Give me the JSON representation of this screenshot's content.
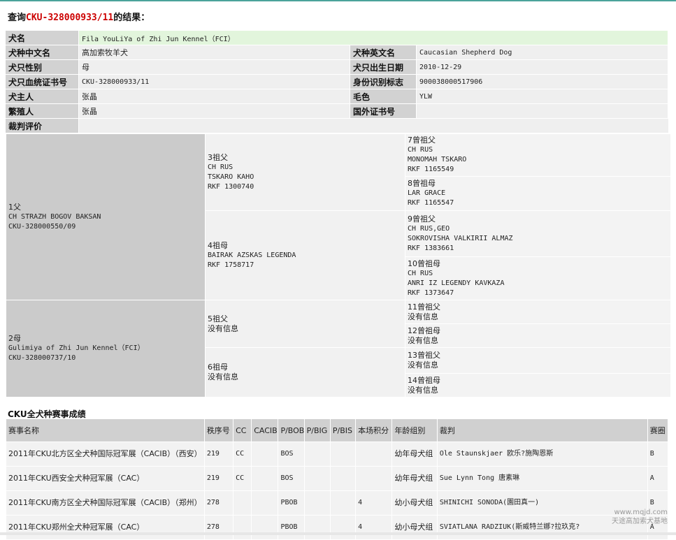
{
  "heading": {
    "prefix": "查询",
    "code": "CKU-328000933/11",
    "suffix": "的结果："
  },
  "info": {
    "name_label": "犬名",
    "name_value": "Fila YouLiYa of Zhi Jun Kennel（FCI）",
    "breed_cn_label": "犬种中文名",
    "breed_cn_value": "高加索牧羊犬",
    "breed_en_label": "犬种英文名",
    "breed_en_value": "Caucasian Shepherd Dog",
    "sex_label": "犬只性别",
    "sex_value": "母",
    "birth_label": "犬只出生日期",
    "birth_value": "2010-12-29",
    "reg_label": "犬只血统证书号",
    "reg_value": "CKU-328000933/11",
    "id_label": "身份识别标志",
    "id_value": "900038000517906",
    "owner_label": "犬主人",
    "owner_value": "张晶",
    "color_label": "毛色",
    "color_value": "YLW",
    "breeder_label": "繁殖人",
    "breeder_value": "张晶",
    "foreign_label": "国外证书号",
    "foreign_value": "",
    "judge_label": "裁判评价",
    "judge_value": ""
  },
  "pedigree": {
    "p1": {
      "title": "1父",
      "l1": "CH STRAZH BOGOV BAKSAN",
      "l2": "CKU-328000550/09"
    },
    "p2": {
      "title": "2母",
      "l1": "Gulimiya of Zhi Jun Kennel（FCI）",
      "l2": "CKU-328000737/10"
    },
    "g3": {
      "title": "3祖父",
      "l1": "CH RUS",
      "l2": "TSKARO KAHO",
      "l3": "RKF 1300740"
    },
    "g4": {
      "title": "4祖母",
      "l1": "BAIRAK AZSKAS LEGENDA",
      "l2": "RKF 1758717"
    },
    "g5": {
      "title": "5祖父",
      "l1": "没有信息"
    },
    "g6": {
      "title": "6祖母",
      "l1": "没有信息"
    },
    "gg7": {
      "title": "7曾祖父",
      "l1": "CH RUS",
      "l2": "MONOMAH TSKARO",
      "l3": "RKF 1165549"
    },
    "gg8": {
      "title": "8曾祖母",
      "l1": "LAR GRACE",
      "l2": "RKF 1165547"
    },
    "gg9": {
      "title": "9曾祖父",
      "l1": "CH RUS,GEO",
      "l2": "SOKROVISHA VALKIRII ALMAZ",
      "l3": "RKF 1383661"
    },
    "gg10": {
      "title": "10曾祖母",
      "l1": "CH RUS",
      "l2": "ANRI IZ LEGENDY KAVKAZA",
      "l3": "RKF 1373647"
    },
    "gg11": {
      "title": "11曾祖父",
      "l1": "没有信息"
    },
    "gg12": {
      "title": "12曾祖母",
      "l1": "没有信息"
    },
    "gg13": {
      "title": "13曾祖父",
      "l1": "没有信息"
    },
    "gg14": {
      "title": "14曾祖母",
      "l1": "没有信息"
    }
  },
  "shows": {
    "title": "CKU全犬种赛事成绩",
    "headers": [
      "赛事名称",
      "秩序号",
      "CC",
      "CACIB",
      "P/BOB",
      "P/BIG",
      "P/BIS",
      "本场积分",
      "年龄组别",
      "裁判",
      "赛圈"
    ],
    "rows": [
      [
        "2011年CKU北方区全犬种国际冠军展（CACIB）（西安）",
        "219",
        "CC",
        "",
        "BOS",
        "",
        "",
        "",
        "幼年母犬组",
        "Ole Staunskjaer 欧乐?施陶恩斯",
        "B"
      ],
      [
        "2011年CKU西安全犬种冠军展（CAC）",
        "219",
        "CC",
        "",
        "BOS",
        "",
        "",
        "",
        "幼年母犬组",
        "Sue Lynn Tong 唐素琳",
        "A"
      ],
      [
        "2011年CKU南方区全犬种国际冠军展（CACIB）（郑州）",
        "278",
        "",
        "",
        "PBOB",
        "",
        "",
        "4",
        "幼小母犬组",
        "SHINICHI SONODA(園田真一)",
        "B"
      ],
      [
        "2011年CKU郑州全犬种冠军展（CAC）",
        "278",
        "",
        "",
        "PBOB",
        "",
        "",
        "4",
        "幼小母犬组",
        "SVIATLANA RADZIUK(斯威特兰娜?拉玖克?",
        "A"
      ]
    ]
  },
  "watermark": {
    "site": "www.mqjd.com",
    "text": "天途高加索犬基地"
  }
}
